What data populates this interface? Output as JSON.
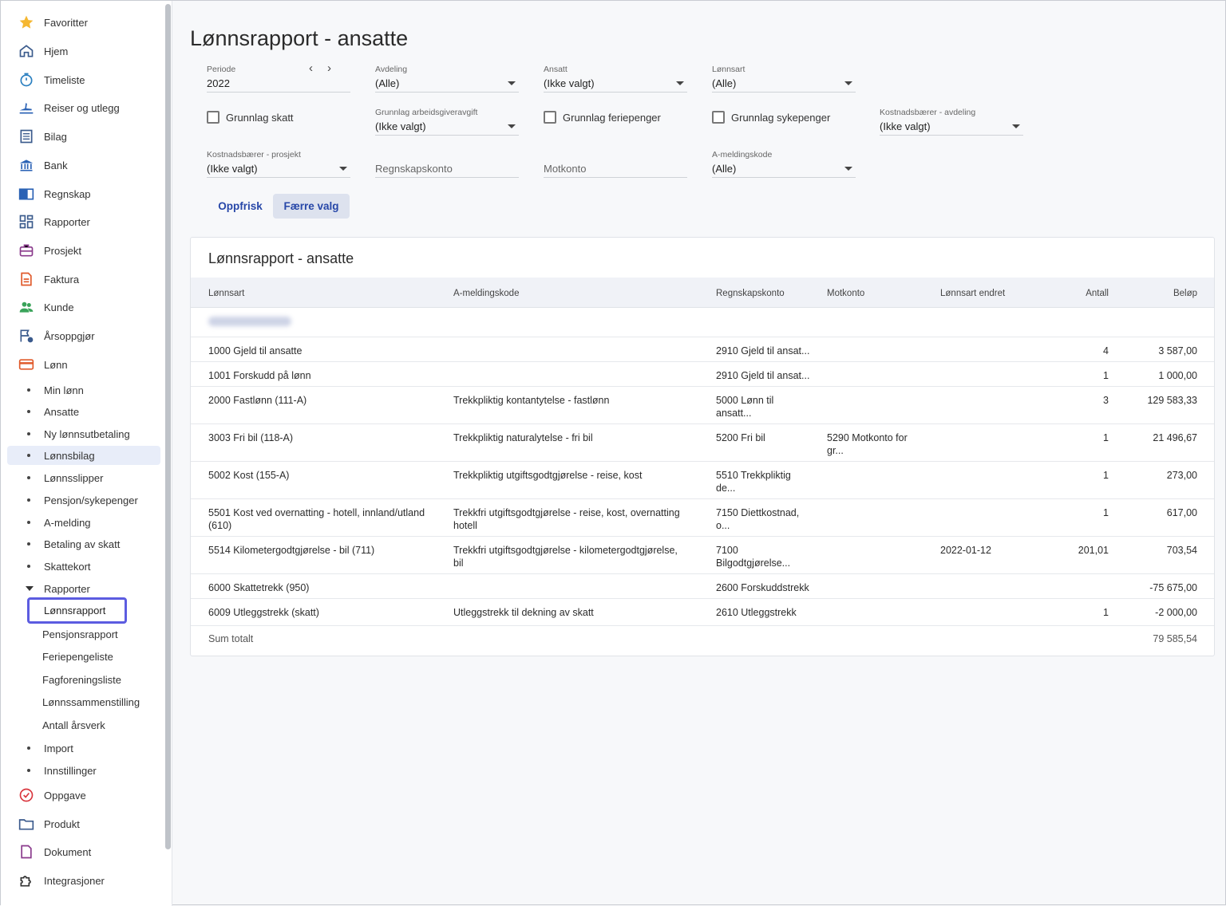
{
  "sidebar": {
    "items": [
      {
        "label": "Favoritter",
        "icon": "star-icon"
      },
      {
        "label": "Hjem",
        "icon": "home-icon"
      },
      {
        "label": "Timeliste",
        "icon": "stopwatch-icon"
      },
      {
        "label": "Reiser og utlegg",
        "icon": "airplane-icon"
      },
      {
        "label": "Bilag",
        "icon": "document-list-icon"
      },
      {
        "label": "Bank",
        "icon": "bank-icon"
      },
      {
        "label": "Regnskap",
        "icon": "book-icon"
      },
      {
        "label": "Rapporter",
        "icon": "dashboard-icon"
      },
      {
        "label": "Prosjekt",
        "icon": "briefcase-icon"
      },
      {
        "label": "Faktura",
        "icon": "invoice-icon"
      },
      {
        "label": "Kunde",
        "icon": "people-icon"
      },
      {
        "label": "Årsoppgjør",
        "icon": "flag-clock-icon"
      },
      {
        "label": "Lønn",
        "icon": "wallet-icon"
      }
    ],
    "lonn_sub": [
      "Min lønn",
      "Ansatte",
      "Ny lønnsutbetaling",
      "Lønnsbilag",
      "Lønnsslipper",
      "Pensjon/sykepenger",
      "A-melding",
      "Betaling av skatt",
      "Skattekort",
      "Rapporter"
    ],
    "rapporter_sub": [
      "Lønnsrapport",
      "Pensjonsrapport",
      "Feriepengeliste",
      "Fagforeningsliste",
      "Lønnssammenstilling",
      "Antall årsverk"
    ],
    "lonn_sub_tail": [
      "Import",
      "Innstillinger"
    ],
    "items_tail": [
      {
        "label": "Oppgave",
        "icon": "check-circle-icon"
      },
      {
        "label": "Produkt",
        "icon": "folder-icon"
      },
      {
        "label": "Dokument",
        "icon": "file-icon"
      },
      {
        "label": "Integrasjoner",
        "icon": "puzzle-icon"
      }
    ]
  },
  "page": {
    "title": "Lønnsrapport - ansatte"
  },
  "filters": {
    "periode": {
      "label": "Periode",
      "value": "2022"
    },
    "avdeling": {
      "label": "Avdeling",
      "value": "(Alle)"
    },
    "ansatt": {
      "label": "Ansatt",
      "value": "(Ikke valgt)"
    },
    "lonnsart": {
      "label": "Lønnsart",
      "value": "(Alle)"
    },
    "grunnlag_skatt": "Grunnlag skatt",
    "grunnlag_aga": {
      "label": "Grunnlag arbeidsgiveravgift",
      "value": "(Ikke valgt)"
    },
    "grunnlag_feriepenger": "Grunnlag feriepenger",
    "grunnlag_sykepenger": "Grunnlag sykepenger",
    "kostnad_avdeling": {
      "label": "Kostnadsbærer - avdeling",
      "value": "(Ikke valgt)"
    },
    "kostnad_prosjekt": {
      "label": "Kostnadsbærer - prosjekt",
      "value": "(Ikke valgt)"
    },
    "regnskapskonto": {
      "placeholder": "Regnskapskonto"
    },
    "motkonto": {
      "placeholder": "Motkonto"
    },
    "a_meldingskode": {
      "label": "A-meldingskode",
      "value": "(Alle)"
    }
  },
  "buttons": {
    "refresh": "Oppfrisk",
    "fewer": "Færre valg"
  },
  "report": {
    "title": "Lønnsrapport - ansatte",
    "columns": [
      "Lønnsart",
      "A-meldingskode",
      "Regnskapskonto",
      "Motkonto",
      "Lønnsart endret",
      "Antall",
      "Beløp"
    ],
    "rows": [
      {
        "lonnsart": "1000 Gjeld til ansatte",
        "amelding": "",
        "regnskap": "2910 Gjeld til ansat...",
        "motkonto": "",
        "endret": "",
        "antall": "4",
        "belop": "3 587,00"
      },
      {
        "lonnsart": "1001 Forskudd på lønn",
        "amelding": "",
        "regnskap": "2910 Gjeld til ansat...",
        "motkonto": "",
        "endret": "",
        "antall": "1",
        "belop": "1 000,00"
      },
      {
        "lonnsart": "2000 Fastlønn (111-A)",
        "amelding": "Trekkpliktig kontantytelse - fastlønn",
        "regnskap": "5000 Lønn til\nansatt...",
        "motkonto": "",
        "endret": "",
        "antall": "3",
        "belop": "129 583,33"
      },
      {
        "lonnsart": "3003 Fri bil (118-A)",
        "amelding": "Trekkpliktig naturalytelse - fri bil",
        "regnskap": "5200 Fri bil",
        "motkonto": "5290 Motkonto for\ngr...",
        "endret": "",
        "antall": "1",
        "belop": "21 496,67"
      },
      {
        "lonnsart": "5002 Kost (155-A)",
        "amelding": "Trekkpliktig utgiftsgodtgjørelse - reise, kost",
        "regnskap": "5510 Trekkpliktig\nde...",
        "motkonto": "",
        "endret": "",
        "antall": "1",
        "belop": "273,00"
      },
      {
        "lonnsart": "5501 Kost ved overnatting - hotell, innland/utland\n(610)",
        "amelding": "Trekkfri utgiftsgodtgjørelse - reise, kost, overnatting\nhotell",
        "regnskap": "7150 Diettkostnad,\no...",
        "motkonto": "",
        "endret": "",
        "antall": "1",
        "belop": "617,00"
      },
      {
        "lonnsart": "5514 Kilometergodtgjørelse - bil (711)",
        "amelding": "Trekkfri utgiftsgodtgjørelse - kilometergodtgjørelse,\nbil",
        "regnskap": "7100\nBilgodtgjørelse...",
        "motkonto": "",
        "endret": "2022-01-12",
        "antall": "201,01",
        "belop": "703,54"
      },
      {
        "lonnsart": "6000 Skattetrekk (950)",
        "amelding": "",
        "regnskap": "2600 Forskuddstrekk",
        "motkonto": "",
        "endret": "",
        "antall": "",
        "belop": "-75 675,00"
      },
      {
        "lonnsart": "6009 Utleggstrekk (skatt)",
        "amelding": "Utleggstrekk til dekning av skatt",
        "regnskap": "2610 Utleggstrekk",
        "motkonto": "",
        "endret": "",
        "antall": "1",
        "belop": "-2 000,00"
      }
    ],
    "total": {
      "label": "Sum totalt",
      "belop": "79 585,54"
    }
  },
  "colors": {
    "accent": "#2747a8",
    "selected_outline": "#5c5ce0",
    "active_bg": "#e8edf9"
  }
}
